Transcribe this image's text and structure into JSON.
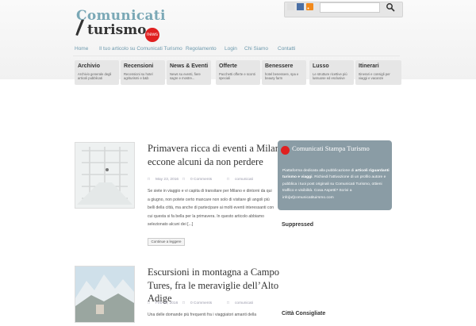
{
  "logo": {
    "line1": "Comunicati",
    "line2": "turismo",
    "badge": "news"
  },
  "search": {
    "placeholder": ""
  },
  "nav": [
    "Home",
    "Il tuo articolo su Comunicati Turismo",
    "Regolamento",
    "Login",
    "Chi Siamo",
    "Contatti"
  ],
  "categories": [
    {
      "title": "Archivio",
      "desc": "Archivio generale degli articoli pubblicati"
    },
    {
      "title": "Recensioni",
      "desc": "Recensioni su hotel agriturismi e b&b"
    },
    {
      "title": "News & Eventi",
      "desc": "News su eventi, fiere sagre e mostre..."
    },
    {
      "title": "Offerte",
      "desc": "Pacchetti offerte e sconti speciali"
    },
    {
      "title": "Benessere",
      "desc": "hotel benessere, spa e beauty farm"
    },
    {
      "title": "Lusso",
      "desc": "Le strutture ricettive più lussuose ed esclusive"
    },
    {
      "title": "Itinerari",
      "desc": "Itinerari e consigli per viaggi e vacanze"
    }
  ],
  "posts": [
    {
      "title": "Primavera ricca di eventi a Milano, eccone alcuni da non perdere",
      "date": "May 23, 2016",
      "comments": "0 Comments",
      "category": "comunicati",
      "excerpt": "Se siete in viaggio e vi capita di transitare per Milano e dintorni da qui a giugno, non potete certo mancare non solo di visitare gli angoli più belli della città, ma anche di partecipare ai molti eventi interessanti con cui questa si fa bella per la primavera. In questo articolo abbiamo selezionato alcuni dei [...]",
      "more": "Continue a leggere"
    },
    {
      "title": "Escursioni in montagna a Campo Tures, fra le meraviglie dell’Alto Adige",
      "date": "Feb 29, 2016",
      "comments": "0 Comments",
      "category": "comunicati",
      "excerpt": "Una delle domande più frequenti fra i viaggiatori amanti della"
    }
  ],
  "sidebar": {
    "box_title": "Comunicati Stampa Turismo",
    "box_text_1": "Piattaforma dedicata alla pubblicazione di ",
    "box_text_bold": "articoli riguardanti turismo e viaggi",
    "box_text_2": ". Richiedi l'attivazione di un profilo autore e pubblica i tuoi post originali su Comunicati Turismo, ottieni traffico e visibilità. Cosa Aspetti? Scrivi a info[at]comunicatituirsmo.com",
    "widget_title": "Suppressed",
    "cities_title": "Città Consigliate"
  },
  "colors": {
    "nav": "#6c99ad",
    "sidebox": "#8a9ca5",
    "badge": "#e02020"
  }
}
